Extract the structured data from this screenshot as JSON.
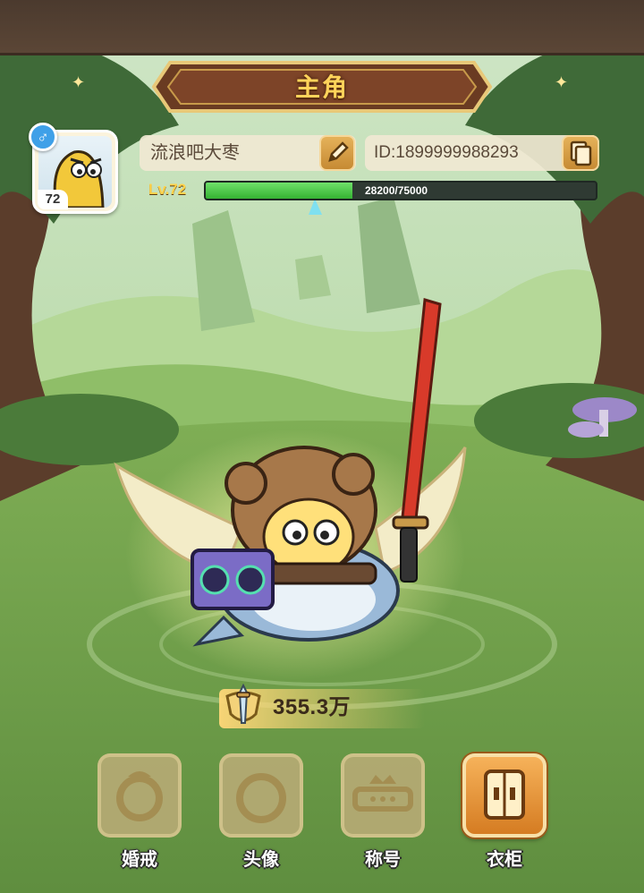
{
  "header": {
    "title": "主角"
  },
  "profile": {
    "avatar_level": "72",
    "gender_symbol": "♂",
    "name": "流浪吧大枣",
    "id_text": "ID:1899999988293",
    "level_label": "Lv.72",
    "xp_text": "28200/75000",
    "xp_progress": 0.376
  },
  "power": {
    "value": "355.3万"
  },
  "menu": {
    "items": [
      {
        "label": "婚戒",
        "icon": "ring-icon",
        "active": false
      },
      {
        "label": "头像",
        "icon": "avatar-icon",
        "active": false
      },
      {
        "label": "称号",
        "icon": "crown-title-icon",
        "active": false
      },
      {
        "label": "衣柜",
        "icon": "wardrobe-icon",
        "active": true
      }
    ]
  },
  "colors": {
    "accent_gold": "#ffd35a",
    "xp_green": "#35b232",
    "gender_blue": "#3fa0e8",
    "top_bar_brown": "#4b3a2e"
  }
}
